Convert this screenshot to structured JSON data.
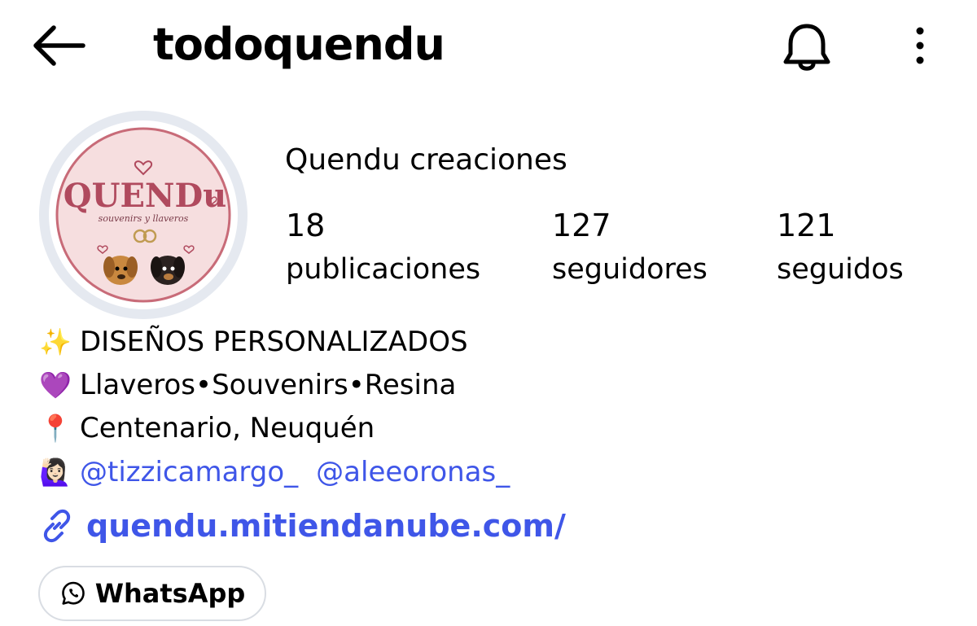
{
  "header": {
    "username": "todoquendu",
    "back_icon": "arrow-left-icon",
    "bell_icon": "bell-icon",
    "more_icon": "more-vertical-icon"
  },
  "profile": {
    "display_name": "Quendu creaciones",
    "avatar": {
      "logo_text": "QUENDu",
      "logo_subtext": "souvenirs y llaveros",
      "colors": {
        "circle": "#f6dedf",
        "border": "#c86b78",
        "text": "#b04a5e"
      }
    },
    "stats": [
      {
        "value": "18",
        "label": "publicaciones"
      },
      {
        "value": "127",
        "label": "seguidores"
      },
      {
        "value": "121",
        "label": "seguidos"
      }
    ]
  },
  "bio": {
    "line1": {
      "emoji": "✨",
      "text": "DISEÑOS PERSONALIZADOS"
    },
    "line2": {
      "emoji": "💜",
      "text": "Llaveros•Souvenirs•Resina"
    },
    "line3": {
      "emoji": "📍",
      "text": "Centenario, Neuquén"
    },
    "line4": {
      "emoji": "🙋🏻‍♀️",
      "mentions": [
        "@tizzicamargo_",
        "@aleeoronas_"
      ]
    }
  },
  "link": {
    "icon": "link-icon",
    "text": "quendu.mitiendanube.com/"
  },
  "whatsapp_button": {
    "icon": "whatsapp-icon",
    "label": "WhatsApp"
  },
  "colors": {
    "accent": "#3f56e8",
    "text": "#000000",
    "pill_border": "#d9dde3"
  }
}
